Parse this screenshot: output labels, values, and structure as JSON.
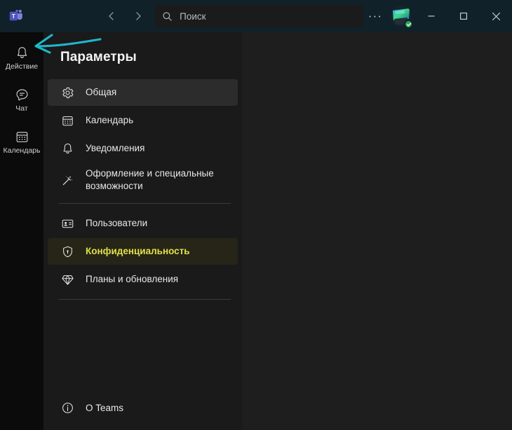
{
  "app": {
    "name": "Microsoft Teams",
    "logo_icon": "teams-logo-icon",
    "background_color": "#121212",
    "titlebar_color": "#11212a"
  },
  "titlebar": {
    "back_icon": "chevron-left-icon",
    "forward_icon": "chevron-right-icon",
    "search": {
      "icon": "search-icon",
      "placeholder": "Поиск",
      "value": ""
    },
    "more_options_label": "···",
    "more_options_icon": "ellipsis-icon",
    "avatar": {
      "icon": "avatar",
      "presence_status": "Доступен",
      "presence_icon": "check-circle-icon",
      "presence_color": "#2aab4f"
    },
    "window_controls": {
      "minimize_icon": "minimize-icon",
      "maximize_icon": "maximize-icon",
      "close_icon": "close-icon"
    }
  },
  "rail": {
    "items": [
      {
        "label": "Действие",
        "icon": "bell-icon",
        "name": "sidebar-item-activity"
      },
      {
        "label": "Чат",
        "icon": "chat-icon",
        "name": "sidebar-item-chat"
      },
      {
        "label": "Календарь",
        "icon": "calendar-icon",
        "name": "sidebar-item-calendar"
      }
    ]
  },
  "settings": {
    "title": "Параметры",
    "groups": [
      {
        "items": [
          {
            "label": "Общая",
            "icon": "gear-icon",
            "state": "hover"
          },
          {
            "label": "Календарь",
            "icon": "calendar-icon",
            "state": "normal"
          },
          {
            "label": "Уведомления",
            "icon": "bell-icon",
            "state": "normal"
          },
          {
            "label": "Оформление и специальные возможности",
            "icon": "magic-wand-icon",
            "state": "normal"
          }
        ]
      },
      {
        "items": [
          {
            "label": "Пользователи",
            "icon": "contact-card-icon",
            "state": "normal"
          },
          {
            "label": "Конфиденциальность",
            "icon": "shield-lock-icon",
            "state": "selected"
          },
          {
            "label": "Планы и обновления",
            "icon": "diamond-icon",
            "state": "normal"
          }
        ]
      }
    ],
    "about": {
      "label": "О Teams",
      "icon": "info-icon"
    },
    "selected_color": "#e2e04a",
    "selected_background": "#262518"
  },
  "annotation": {
    "type": "arrow",
    "color": "#1fb6c9",
    "points_to": "sidebar-item-activity"
  }
}
